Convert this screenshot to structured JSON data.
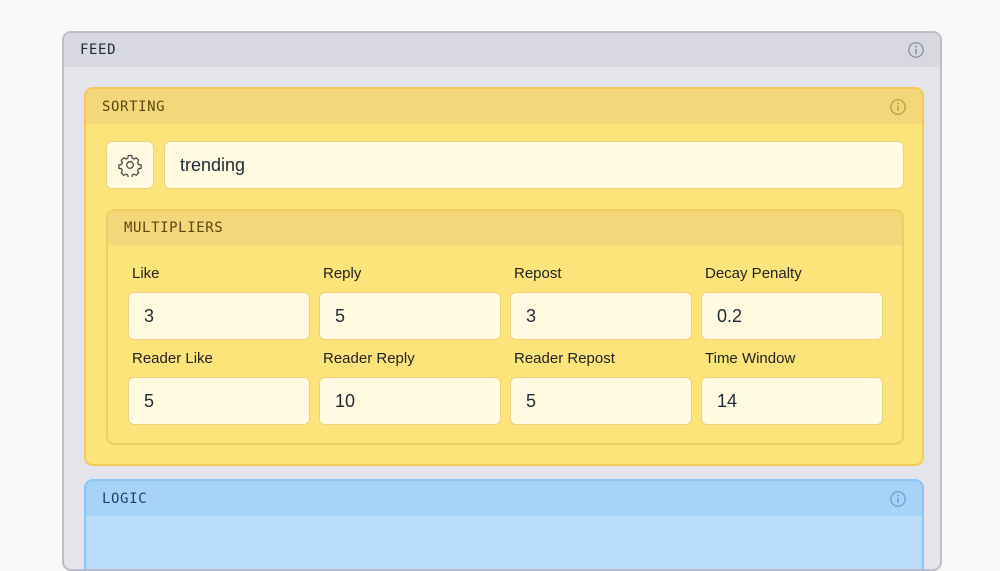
{
  "feed": {
    "title": "FEED",
    "info_icon": "info-icon"
  },
  "sorting": {
    "title": "SORTING",
    "info_icon": "info-icon",
    "settings_icon": "gear-icon",
    "value": "trending"
  },
  "multipliers": {
    "title": "MULTIPLIERS",
    "fields": [
      {
        "label": "Like",
        "value": "3"
      },
      {
        "label": "Reply",
        "value": "5"
      },
      {
        "label": "Repost",
        "value": "3"
      },
      {
        "label": "Decay Penalty",
        "value": "0.2"
      },
      {
        "label": "Reader Like",
        "value": "5"
      },
      {
        "label": "Reader Reply",
        "value": "10"
      },
      {
        "label": "Reader Repost",
        "value": "5"
      },
      {
        "label": "Time Window",
        "value": "14"
      }
    ]
  },
  "logic": {
    "title": "LOGIC",
    "info_icon": "info-icon"
  },
  "colors": {
    "feed_bg": "#e4e4ea",
    "sorting_bg": "#fde47a",
    "logic_bg": "#b9dcf8"
  }
}
